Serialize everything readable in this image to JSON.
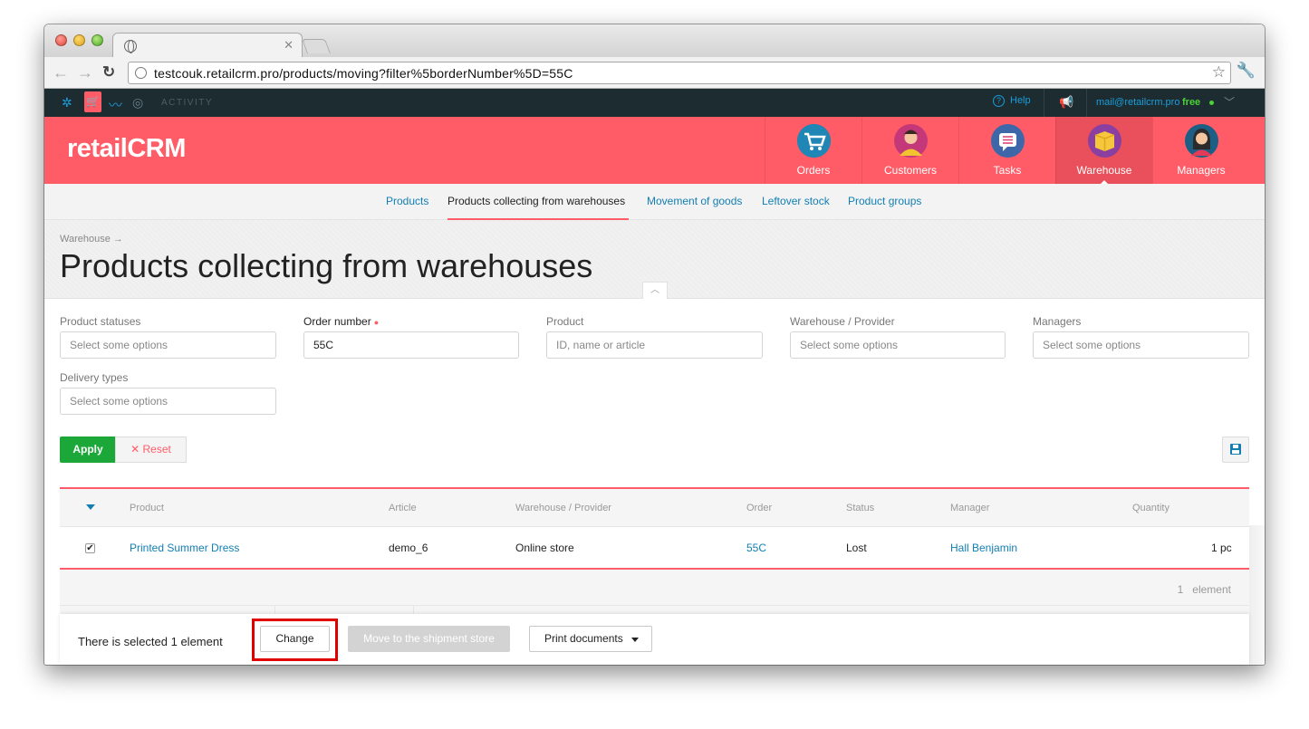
{
  "browser": {
    "url": "testcouk.retailcrm.pro/products/moving?filter%5borderNumber%5D=55C"
  },
  "topbar": {
    "activity": "ACTIVITY",
    "help": "Help",
    "email": "mail@retailcrm.pro",
    "plan": "free"
  },
  "header": {
    "logo": "retailCRM",
    "modules": [
      {
        "label": "Orders"
      },
      {
        "label": "Customers"
      },
      {
        "label": "Tasks"
      },
      {
        "label": "Warehouse"
      },
      {
        "label": "Managers"
      }
    ]
  },
  "subnav": {
    "items": [
      "Products",
      "Products collecting from warehouses",
      "Movement of goods",
      "Leftover stock",
      "Product groups"
    ]
  },
  "page": {
    "breadcrumb": "Warehouse →",
    "title": "Products collecting from warehouses"
  },
  "filters": {
    "product_statuses": {
      "label": "Product statuses",
      "placeholder": "Select some options"
    },
    "order_number": {
      "label": "Order number",
      "value": "55C"
    },
    "product": {
      "label": "Product",
      "placeholder": "ID, name or article"
    },
    "warehouse": {
      "label": "Warehouse / Provider",
      "placeholder": "Select some options"
    },
    "managers": {
      "label": "Managers",
      "placeholder": "Select some options"
    },
    "delivery_types": {
      "label": "Delivery types",
      "placeholder": "Select some options"
    },
    "apply": "Apply",
    "reset": "Reset"
  },
  "table": {
    "columns": [
      "Product",
      "Article",
      "Warehouse / Provider",
      "Order",
      "Status",
      "Manager",
      "Quantity"
    ],
    "rows": [
      {
        "product": "Printed Summer Dress",
        "article": "demo_6",
        "warehouse": "Online store",
        "order": "55C",
        "status": "Lost",
        "manager": "Hall Benjamin",
        "quantity": "1 pc",
        "checked": true
      }
    ],
    "count": "1",
    "count_label": "element"
  },
  "actions": {
    "selected_text": "There is selected 1 element",
    "change": "Change",
    "move": "Move to the shipment store",
    "print": "Print documents"
  },
  "colors": {
    "brand": "#ff5c67",
    "link": "#127eb3",
    "apply": "#1ba839",
    "highlight": "#e00000"
  }
}
